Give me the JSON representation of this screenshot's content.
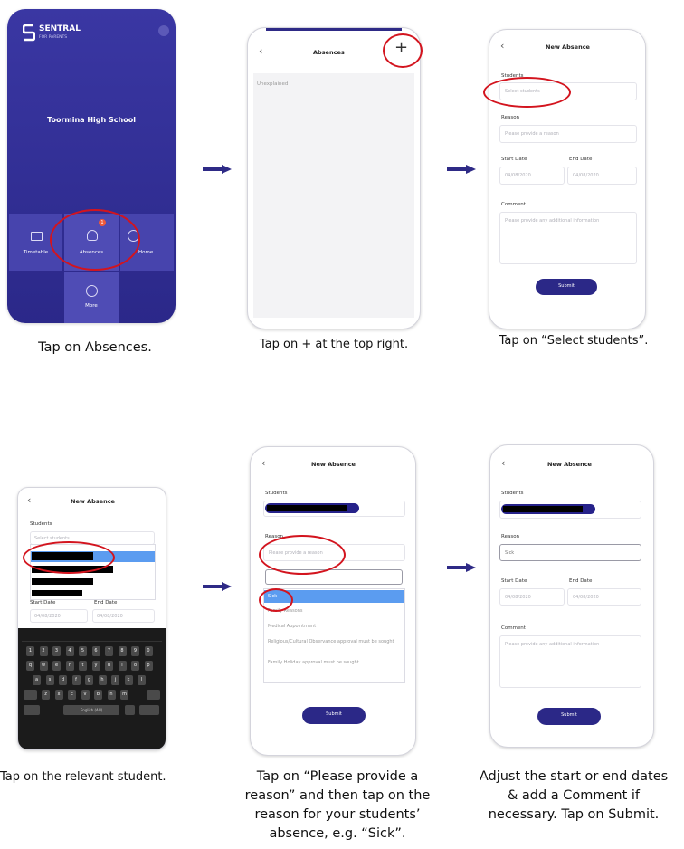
{
  "steps": {
    "s1": {
      "caption": "Tap on Absences.",
      "brand": "SENTRAL",
      "brand_sub": "FOR PARENTS",
      "school": "Toormina High School",
      "tiles": [
        "Timetable",
        "Absences",
        "Home"
      ],
      "badge": "1",
      "more": "More"
    },
    "s2": {
      "caption": "Tap on + at the top right.",
      "title": "Absences",
      "plus": "+",
      "row": "Unexplained"
    },
    "s3": {
      "caption": "Tap on “Select students”.",
      "title": "New Absence",
      "students_label": "Students",
      "students_ph": "Select students",
      "reason_label": "Reason",
      "reason_ph": "Please provide a reason",
      "start_label": "Start Date",
      "end_label": "End Date",
      "start_val": "04/08/2020",
      "end_val": "04/08/2020",
      "comment_label": "Comment",
      "comment_ph": "Please provide any additional information",
      "submit": "Submit"
    },
    "s4": {
      "caption": "Tap on the relevant student.",
      "title": "New Absence",
      "students_label": "Students",
      "students_ph": "Select students",
      "start_label": "Start Date",
      "end_label": "End Date",
      "start_val": "04/08/2020",
      "end_val": "04/08/2020",
      "keyboard_rows": [
        "1234567890",
        "qwertyuiop",
        "asdfghjkl",
        "zxcvbnm"
      ],
      "space": "English (AU)"
    },
    "s5": {
      "caption_lines": [
        "Tap on “Please provide a",
        "reason” and then tap on the",
        "reason for your students’",
        "absence, e.g. “Sick”."
      ],
      "title": "New Absence",
      "students_label": "Students",
      "reason_label": "Reason",
      "reason_ph": "Please provide a reason",
      "options": [
        "Sick",
        "Family Reasons",
        "Medical Appointment",
        "Religious/Cultural Observance approval must be sought",
        "Family Holiday approval must be sought"
      ],
      "submit": "Submit"
    },
    "s6": {
      "caption_lines": [
        "Adjust the start or end dates",
        "& add a Comment if",
        "necessary.  Tap on Submit."
      ],
      "title": "New Absence",
      "students_label": "Students",
      "reason_label": "Reason",
      "reason_val": "Sick",
      "start_label": "Start Date",
      "end_label": "End Date",
      "start_val": "04/08/2020",
      "end_val": "04/08/2020",
      "comment_label": "Comment",
      "comment_ph": "Please provide any additional information",
      "submit": "Submit"
    }
  },
  "colors": {
    "brand": "#2e2a86",
    "highlight": "#d3141e",
    "selected": "#5b9cf0"
  }
}
